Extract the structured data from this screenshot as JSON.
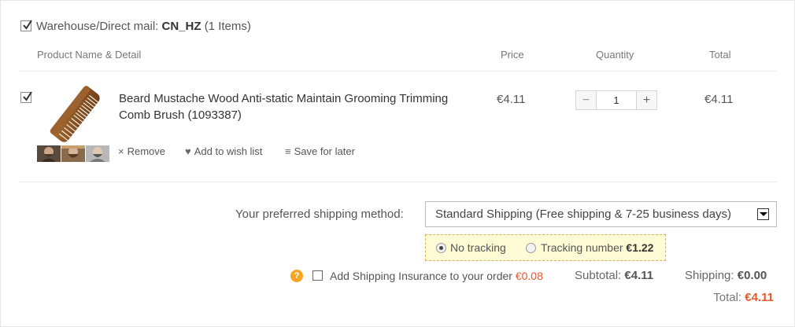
{
  "warehouse": {
    "label": "Warehouse/Direct mail:",
    "code": "CN_HZ",
    "count": "(1 Items)",
    "checked": true
  },
  "table_header": {
    "product": "Product Name & Detail",
    "price": "Price",
    "quantity": "Quantity",
    "total": "Total"
  },
  "item": {
    "checked": true,
    "name": "Beard Mustache Wood Anti-static Maintain Grooming Trimming Comb Brush (1093387)",
    "price": "€4.11",
    "quantity": "1",
    "total": "€4.11",
    "actions": {
      "remove": "Remove",
      "wishlist": "Add to wish list",
      "save": "Save for later"
    }
  },
  "shipping": {
    "label": "Your preferred shipping method:",
    "selected": "Standard Shipping (Free shipping & 7-25 business days)",
    "tracking_options": {
      "no_tracking": "No tracking",
      "tracking_number": "Tracking number",
      "tracking_price": "€1.22",
      "selected": "no_tracking"
    }
  },
  "insurance": {
    "label": "Add Shipping Insurance to your order",
    "price": "€0.08",
    "checked": false
  },
  "summary": {
    "subtotal_label": "Subtotal:",
    "subtotal": "€4.11",
    "shipping_label": "Shipping:",
    "shipping": "€0.00",
    "total_label": "Total:",
    "total": "€4.11"
  },
  "colors": {
    "accent": "#e8572b",
    "help": "#f5a623",
    "tracking_bg": "#fffbd5"
  }
}
